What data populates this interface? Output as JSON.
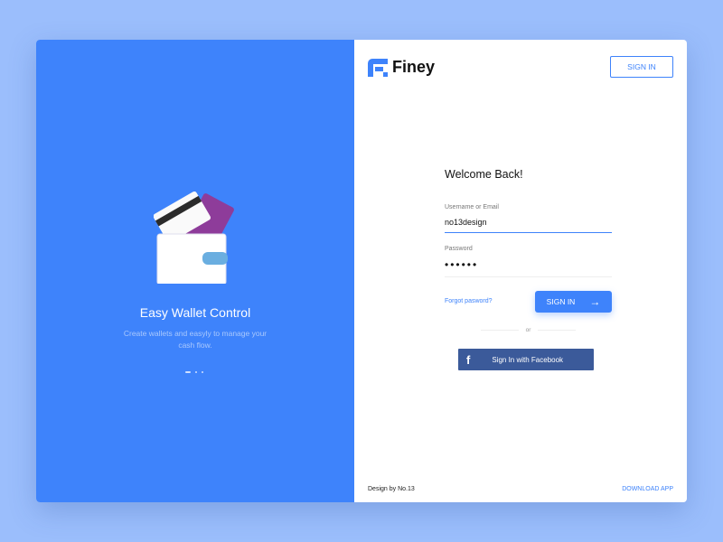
{
  "brand": {
    "name": "Finey",
    "accent": "#3e83fb"
  },
  "header": {
    "sign_in_label": "SIGN IN"
  },
  "hero": {
    "title": "Easy Wallet Control",
    "subtitle_line1": "Create wallets and easyly to manage your",
    "subtitle_line2": "cash flow.",
    "slides": 3,
    "active_slide": 1
  },
  "form": {
    "title": "Welcome Back!",
    "username_label": "Username or Email",
    "username_value": "no13design",
    "password_label": "Password",
    "password_value": "••••••",
    "forgot_label": "Forgot pasword?",
    "sign_in_label": "SIGN IN",
    "or_label": "or",
    "facebook_label": "Sign In with Facebook",
    "facebook_color": "#3b5a9a"
  },
  "footer": {
    "credit": "Design by No.13",
    "download_label": "DOWNLOAD APP"
  }
}
